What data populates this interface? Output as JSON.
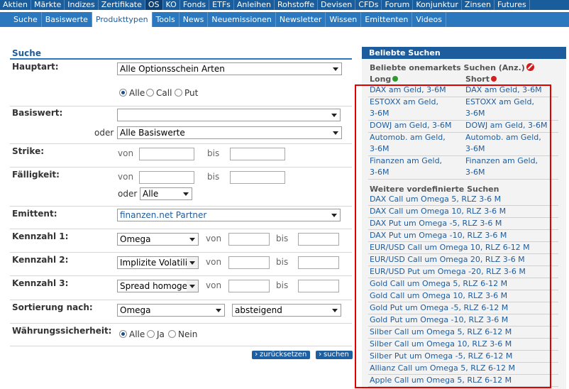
{
  "nav": {
    "primary": [
      "Aktien",
      "Märkte",
      "Indizes",
      "Zertifikate",
      "OS",
      "KO",
      "Fonds",
      "ETFs",
      "Anleihen",
      "Rohstoffe",
      "Devisen",
      "CFDs",
      "Forum",
      "Konjunktur",
      "Zinsen",
      "Futures"
    ],
    "primary_active": "OS",
    "secondary": [
      "Suche",
      "Basiswerte",
      "Produkttypen",
      "Tools",
      "News",
      "Neuemissionen",
      "Newsletter",
      "Wissen",
      "Emittenten",
      "Videos"
    ],
    "secondary_active": "Produkttypen"
  },
  "form": {
    "title": "Suche",
    "hauptart": {
      "label": "Hauptart:",
      "value": "Alle Optionsschein Arten"
    },
    "type_radios": {
      "alle": "Alle",
      "call": "Call",
      "put": "Put",
      "selected": "Alle"
    },
    "basiswert": {
      "label": "Basiswert:",
      "value1": "",
      "oder": "oder",
      "value2": "Alle Basiswerte"
    },
    "strike": {
      "label": "Strike:",
      "von": "von",
      "bis": "bis",
      "von_value": "",
      "bis_value": ""
    },
    "faelligkeit": {
      "label": "Fälligkeit:",
      "von": "von",
      "bis": "bis",
      "oder": "oder",
      "select_value": "Alle"
    },
    "emittent": {
      "label": "Emittent:",
      "value": "finanzen.net Partner"
    },
    "kennzahl1": {
      "label": "Kennzahl 1:",
      "value": "Omega",
      "von": "von",
      "bis": "bis"
    },
    "kennzahl2": {
      "label": "Kennzahl 2:",
      "value": "Implizite Volatilitä",
      "von": "von",
      "bis": "bis"
    },
    "kennzahl3": {
      "label": "Kennzahl 3:",
      "value": "Spread homoger",
      "von": "von",
      "bis": "bis"
    },
    "sortierung": {
      "label": "Sortierung nach:",
      "field": "Omega",
      "order": "absteigend"
    },
    "waehrung": {
      "label": "Währungssicherheit:",
      "alle": "Alle",
      "ja": "Ja",
      "nein": "Nein",
      "selected": "Alle"
    },
    "buttons": {
      "reset": "zurücksetzen",
      "search": "suchen"
    }
  },
  "panel": {
    "title": "Beliebte Suchen",
    "section1": "Beliebte onemarkets Suchen (Anz.)",
    "long_label": "Long",
    "short_label": "Short",
    "pairs": [
      {
        "long": [
          "DAX am Geld, 3-6M"
        ],
        "short": [
          "DAX am Geld, 3-6M"
        ]
      },
      {
        "long": [
          "ESTOXX am Geld,",
          "3-6M"
        ],
        "short": [
          "ESTOXX am Geld,",
          "3-6M"
        ]
      },
      {
        "long": [
          "DOWJ am Geld, 3-6M"
        ],
        "short": [
          "DOWJ am Geld, 3-6M"
        ]
      },
      {
        "long": [
          "Automob. am Geld,",
          "3-6M"
        ],
        "short": [
          "Automob. am Geld,",
          "3-6M"
        ]
      },
      {
        "long": [
          "Finanzen am Geld,",
          "3-6M"
        ],
        "short": [
          "Finanzen am Geld,",
          "3-6M"
        ]
      }
    ],
    "section2": "Weitere vordefinierte Suchen",
    "searches": [
      "DAX Call um Omega 5, RLZ 3-6 M",
      "DAX Call um Omega 10, RLZ 3-6 M",
      "DAX Put um Omega -5, RLZ 3-6 M",
      "DAX Put um Omega -10, RLZ 3-6 M",
      "EUR/USD Call um Omega 10, RLZ 6-12 M",
      "EUR/USD Call um Omega 20, RLZ 3-6 M",
      "EUR/USD Put um Omega -20, RLZ 3-6 M",
      "Gold Call um Omega 5, RLZ 6-12 M",
      "Gold Call um Omega 10, RLZ 3-6 M",
      "Gold Put um Omega -5, RLZ 6-12 M",
      "Gold Put um Omega -10, RLZ 3-6 M",
      "Silber Call um Omega 5, RLZ 6-12 M",
      "Silber Call um Omega 10, RLZ 3-6 M",
      "Silber Put um Omega -5, RLZ 6-12 M",
      "Allianz Call um Omega 5, RLZ 6-12 M",
      "Apple Call um Omega 5, RLZ 6-12 M"
    ]
  },
  "colors": {
    "nav_dark": "#1a5d9d",
    "nav_mid": "#2b78bf",
    "link": "#1d5c9d",
    "highlight_box": "#e00000"
  }
}
